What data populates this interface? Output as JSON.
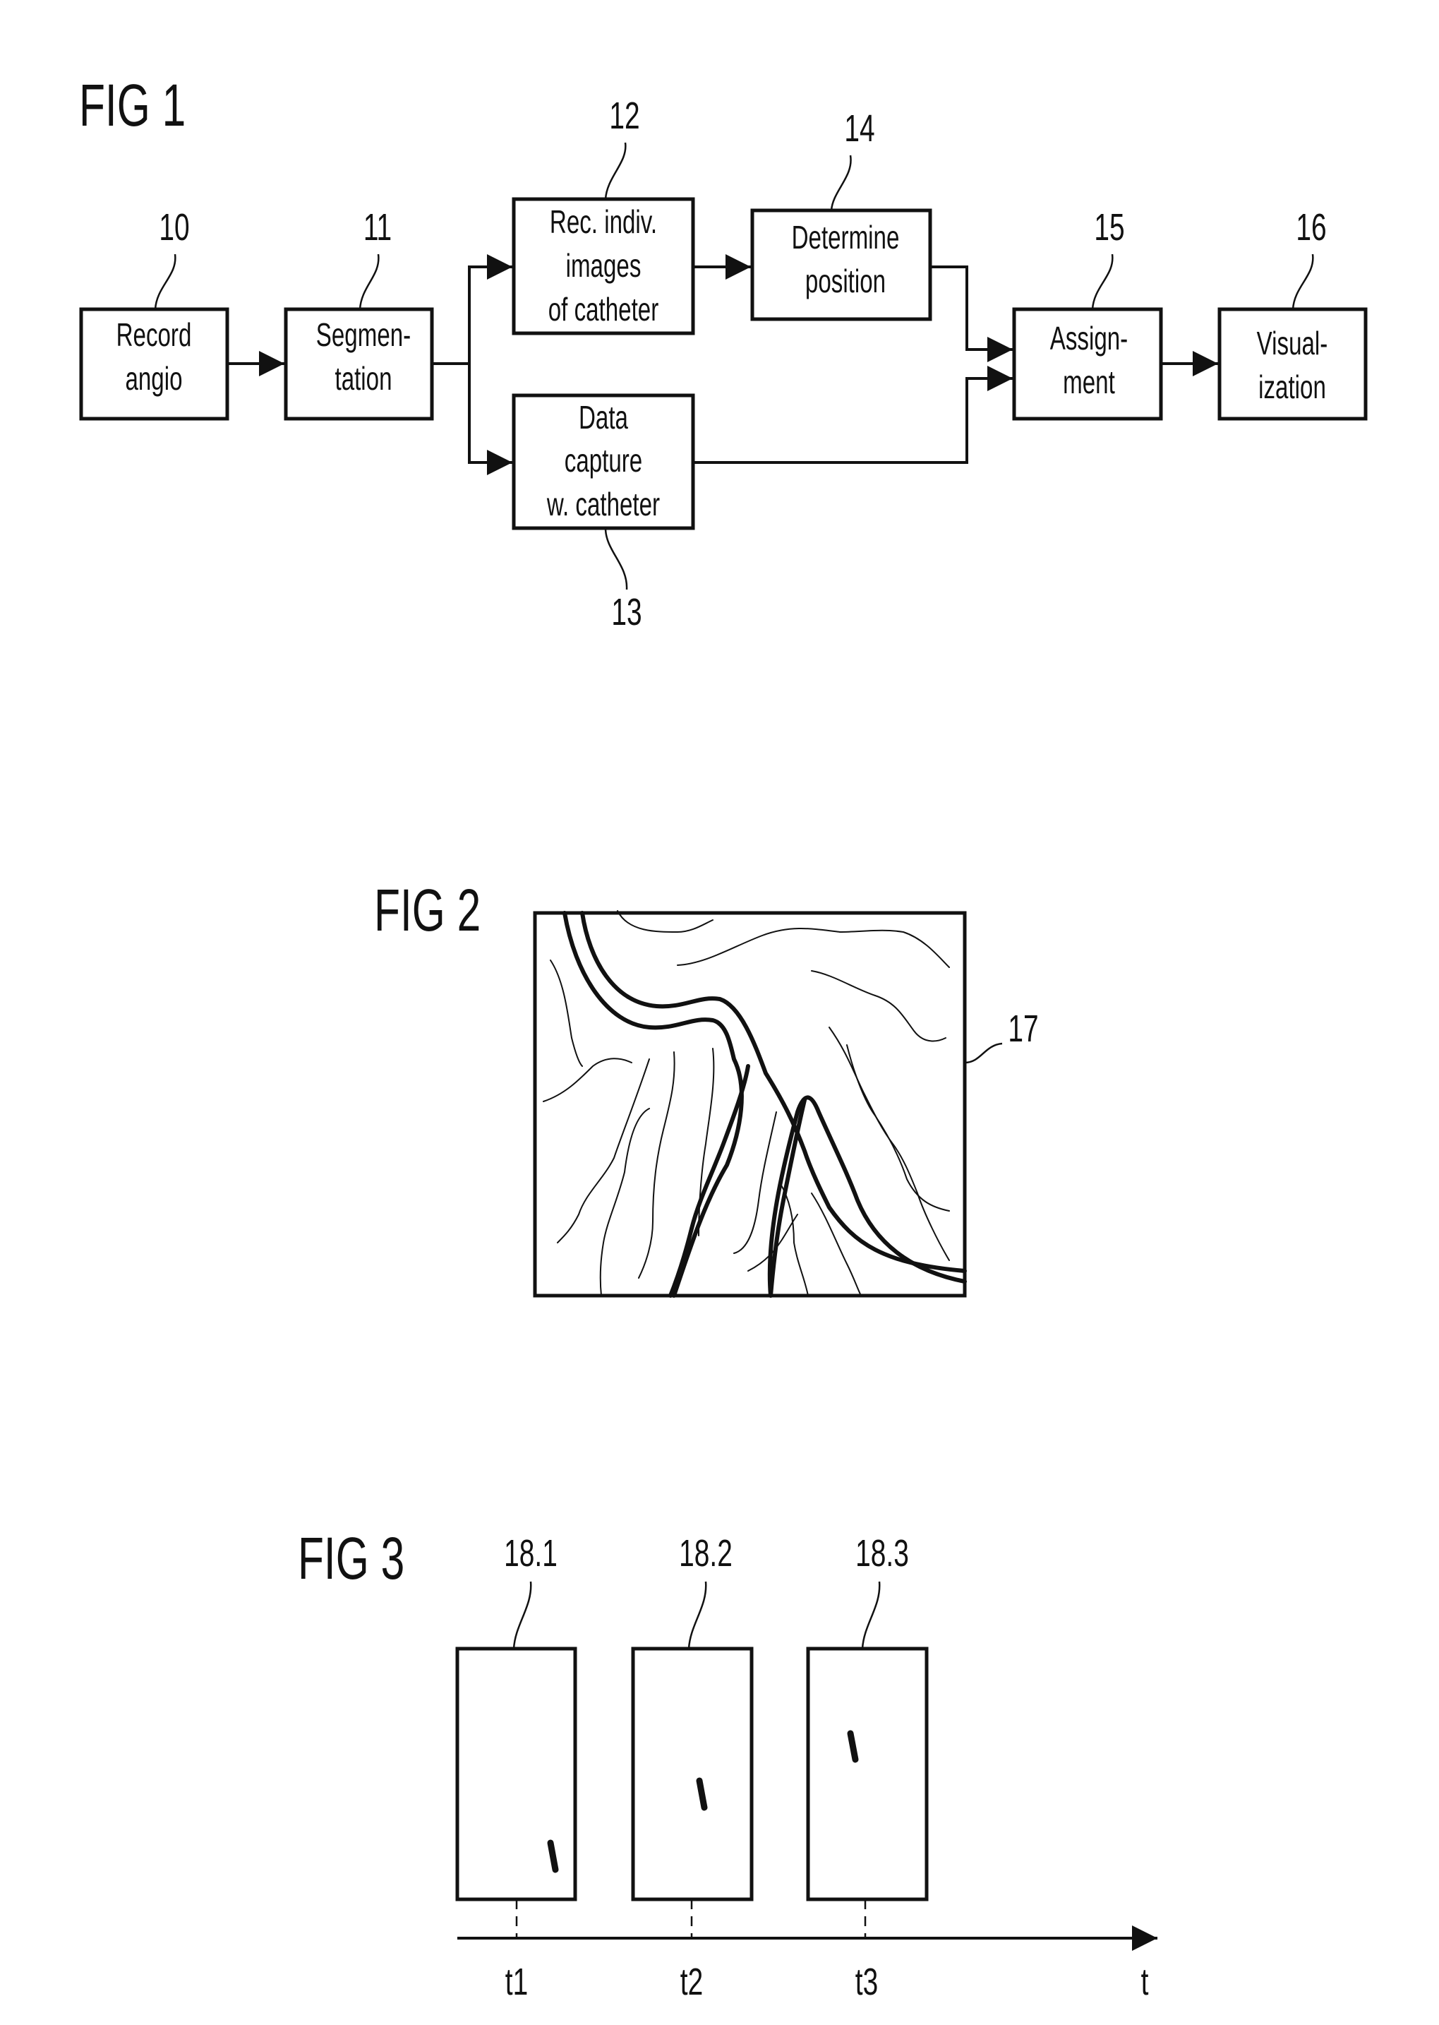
{
  "fig1": {
    "title": "FIG 1",
    "blocks": [
      {
        "ref": "10",
        "lines": [
          "Record",
          "angio"
        ]
      },
      {
        "ref": "11",
        "lines": [
          "Segmen-",
          "tation"
        ]
      },
      {
        "ref": "12",
        "lines": [
          "Rec. indiv.",
          "images",
          "of catheter"
        ]
      },
      {
        "ref": "13",
        "lines": [
          "Data",
          "capture",
          "w. catheter"
        ]
      },
      {
        "ref": "14",
        "lines": [
          "Determine",
          "position"
        ]
      },
      {
        "ref": "15",
        "lines": [
          "Assign-",
          "ment"
        ]
      },
      {
        "ref": "16",
        "lines": [
          "Visual-",
          "ization"
        ]
      }
    ],
    "connections": [
      {
        "from": "10",
        "to": "11"
      },
      {
        "from": "11",
        "to": "12"
      },
      {
        "from": "11",
        "to": "13"
      },
      {
        "from": "12",
        "to": "14"
      },
      {
        "from": "14",
        "to": "15"
      },
      {
        "from": "13",
        "to": "15"
      },
      {
        "from": "15",
        "to": "16"
      }
    ]
  },
  "fig2": {
    "title": "FIG 2",
    "ref": "17",
    "description": "angiogram of vessel tree"
  },
  "fig3": {
    "title": "FIG 3",
    "frames": [
      {
        "ref": "18.1",
        "time": "t1"
      },
      {
        "ref": "18.2",
        "time": "t2"
      },
      {
        "ref": "18.3",
        "time": "t3"
      }
    ],
    "axis_label": "t"
  }
}
